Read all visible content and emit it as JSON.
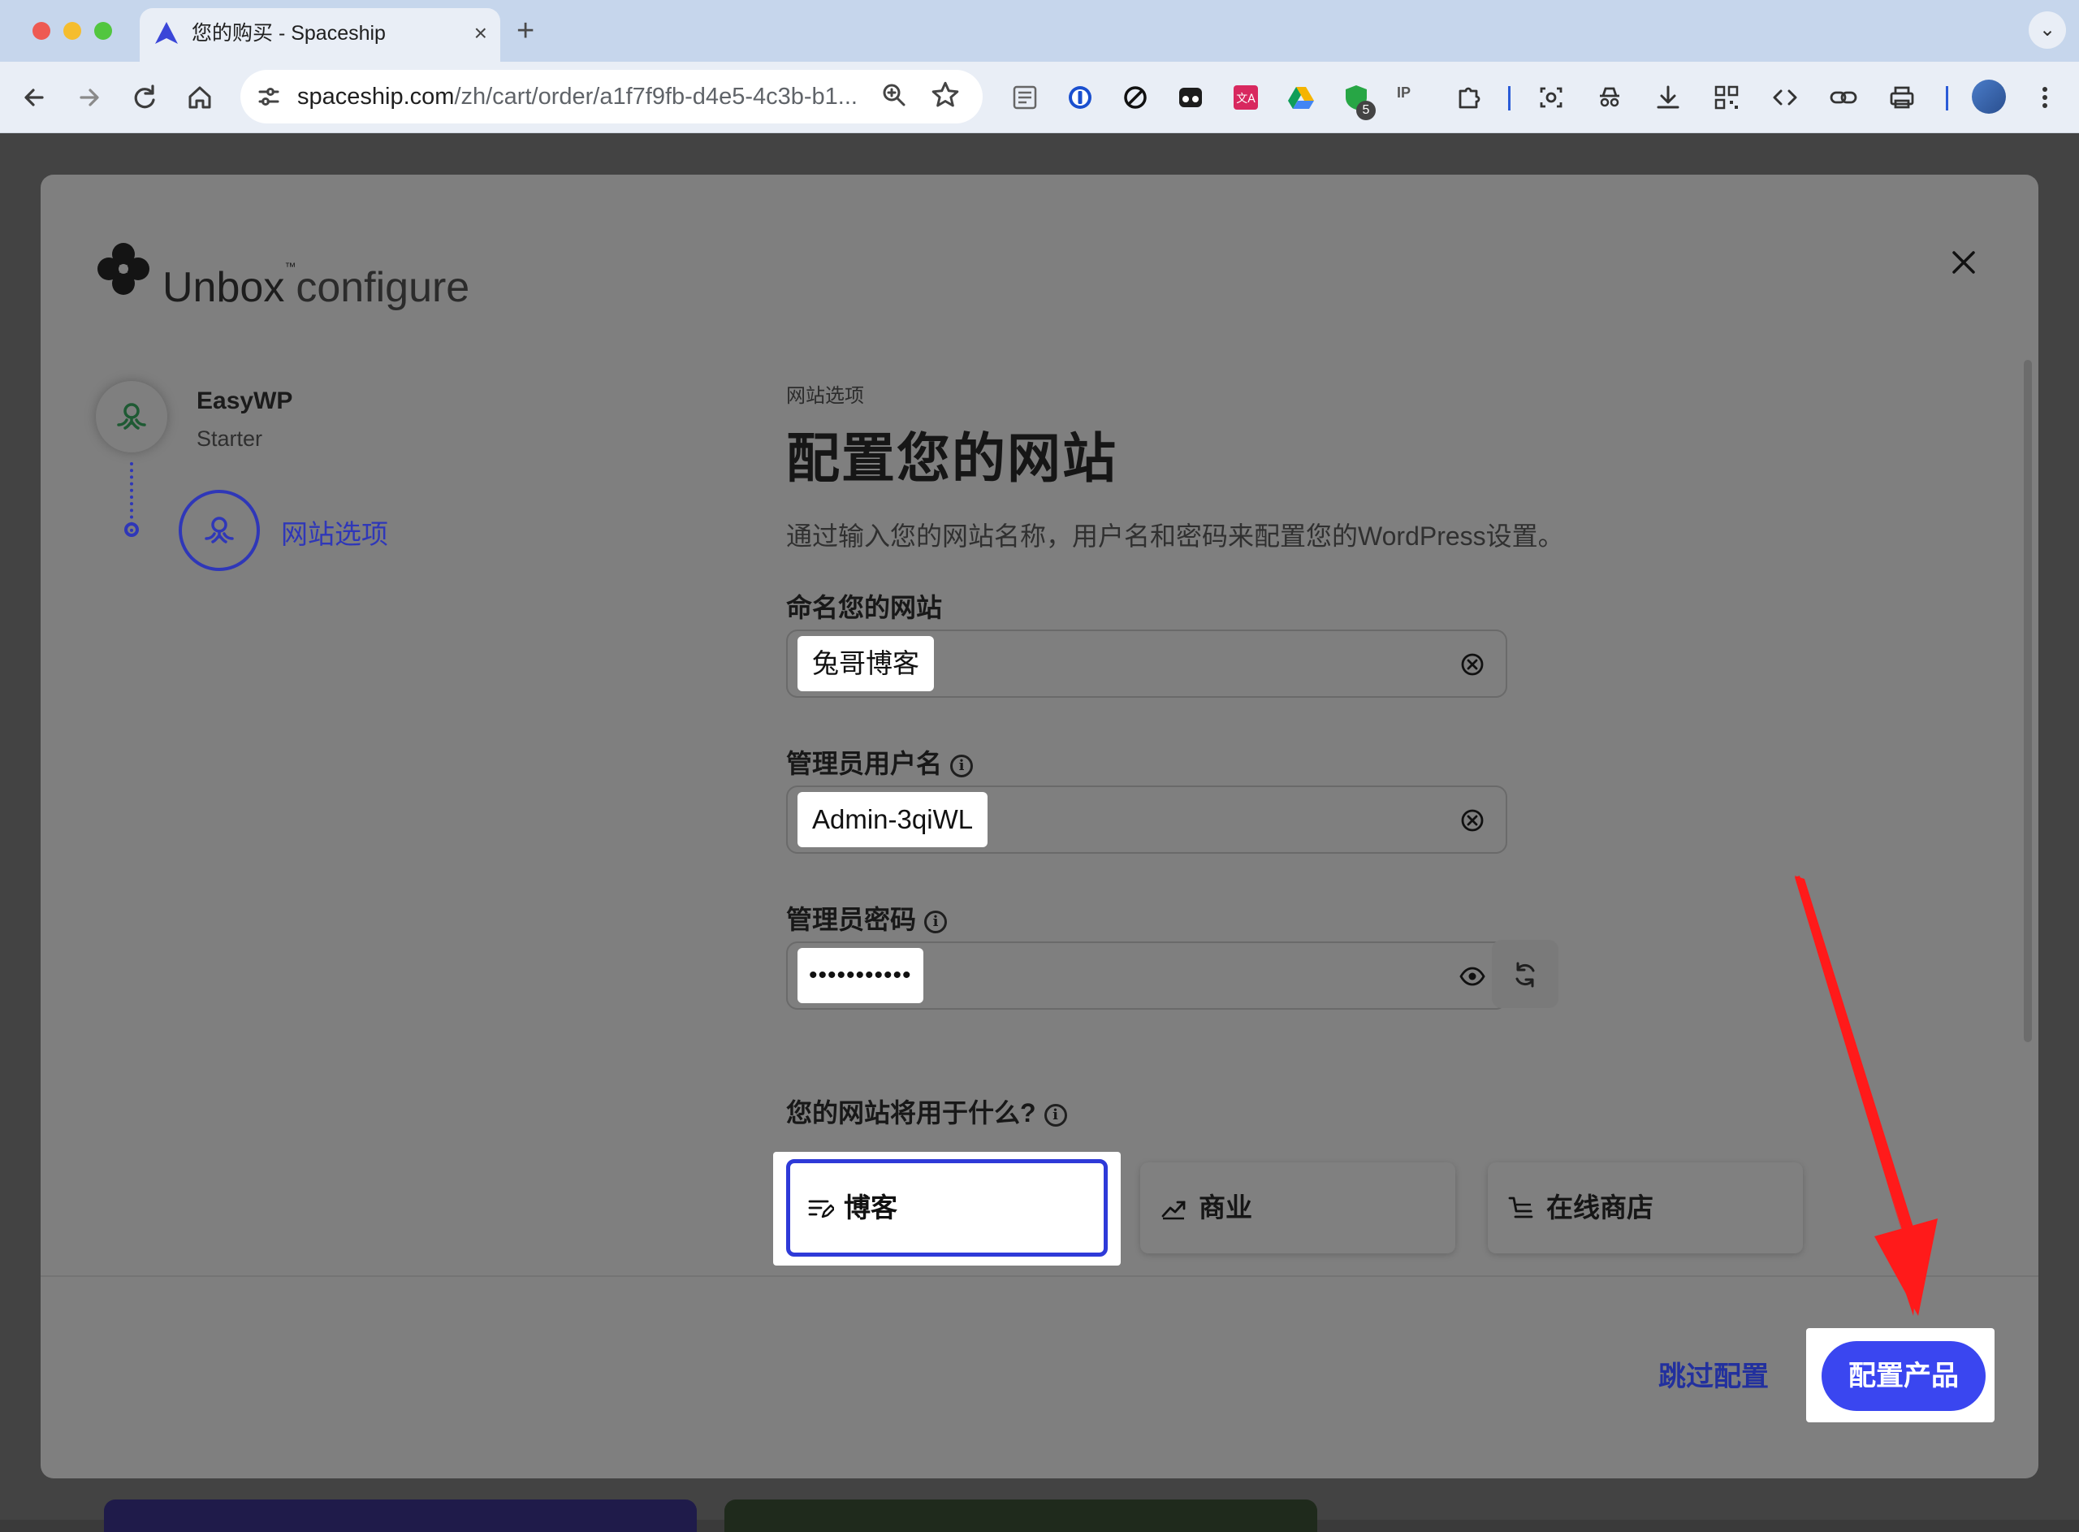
{
  "browser": {
    "tab_title": "您的购买 - Spaceship",
    "tab_close": "×",
    "new_tab": "+",
    "tab_menu": "⌄",
    "url_host": "spaceship.com",
    "url_path": "/zh/cart/order/a1f7f9fb-d4e5-4c3b-b1...",
    "extension_badge": "5",
    "extension_ip": "IP"
  },
  "modal": {
    "brand": "Unbox",
    "brand_tm": "™",
    "brand_suffix": "configure",
    "steps": {
      "product_name": "EasyWP",
      "product_plan": "Starter",
      "current_step": "网站选项"
    },
    "form": {
      "eyebrow": "网站选项",
      "heading": "配置您的网站",
      "description": "通过输入您的网站名称，用户名和密码来配置您的WordPress设置。",
      "site_name_label": "命名您的网站",
      "site_name_value": "兔哥博客",
      "admin_user_label": "管理员用户名",
      "admin_user_value": "Admin-3qiWL",
      "admin_pass_label": "管理员密码",
      "admin_pass_value": "•••••••••••",
      "usage_label": "您的网站将用于什么?",
      "usage_options": [
        {
          "label": "博客",
          "icon": "blog-icon",
          "selected": true
        },
        {
          "label": "商业",
          "icon": "chart-icon",
          "selected": false
        },
        {
          "label": "在线商店",
          "icon": "cart-icon",
          "selected": false
        }
      ]
    },
    "footer": {
      "skip_label": "跳过配置",
      "configure_label": "配置产品"
    }
  },
  "colors": {
    "accent": "#3a46f0",
    "step_blue": "#2f37b8",
    "annotation_red": "#ff1a1a"
  }
}
